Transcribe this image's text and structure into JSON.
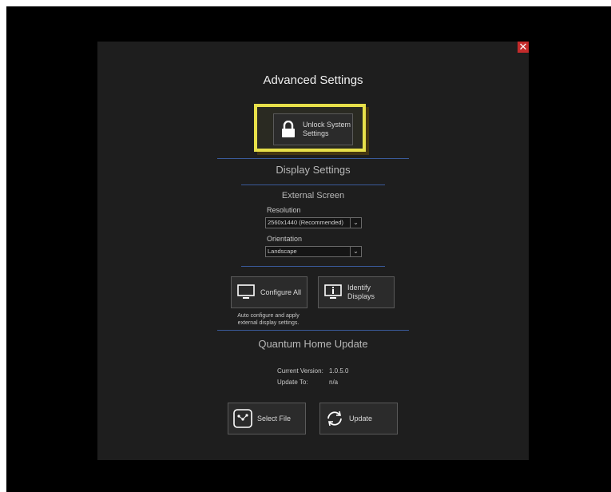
{
  "dialog": {
    "title": "Advanced Settings",
    "close_symbol": "✕",
    "close_icon": "close-icon"
  },
  "unlock": {
    "label_line1": "Unlock System",
    "label_line2": "Settings",
    "icon": "lock-icon",
    "highlight_color": "#e7e04a"
  },
  "display": {
    "section_title": "Display Settings",
    "external_title": "External Screen",
    "resolution_label": "Resolution",
    "resolution_value": "2560x1440 (Recommended)",
    "orientation_label": "Orientation",
    "orientation_value": "Landscape",
    "configure_label": "Configure All",
    "configure_icon": "monitor-icon",
    "identify_label_line1": "Identify",
    "identify_label_line2": "Displays",
    "identify_icon": "monitor-info-icon",
    "caption_line1": "Auto configure and apply",
    "caption_line2": "external display settings."
  },
  "update": {
    "section_title": "Quantum Home Update",
    "current_version_label": "Current Version:",
    "current_version_value": "1.0.5.0",
    "update_to_label": "Update To:",
    "update_to_value": "n/a",
    "select_file_label": "Select File",
    "select_file_icon": "file-select-icon",
    "update_label": "Update",
    "update_icon": "refresh-icon"
  },
  "colors": {
    "dialog_bg": "#1e1e1e",
    "separator": "#3a5a9a",
    "close": "#c42b2b"
  }
}
